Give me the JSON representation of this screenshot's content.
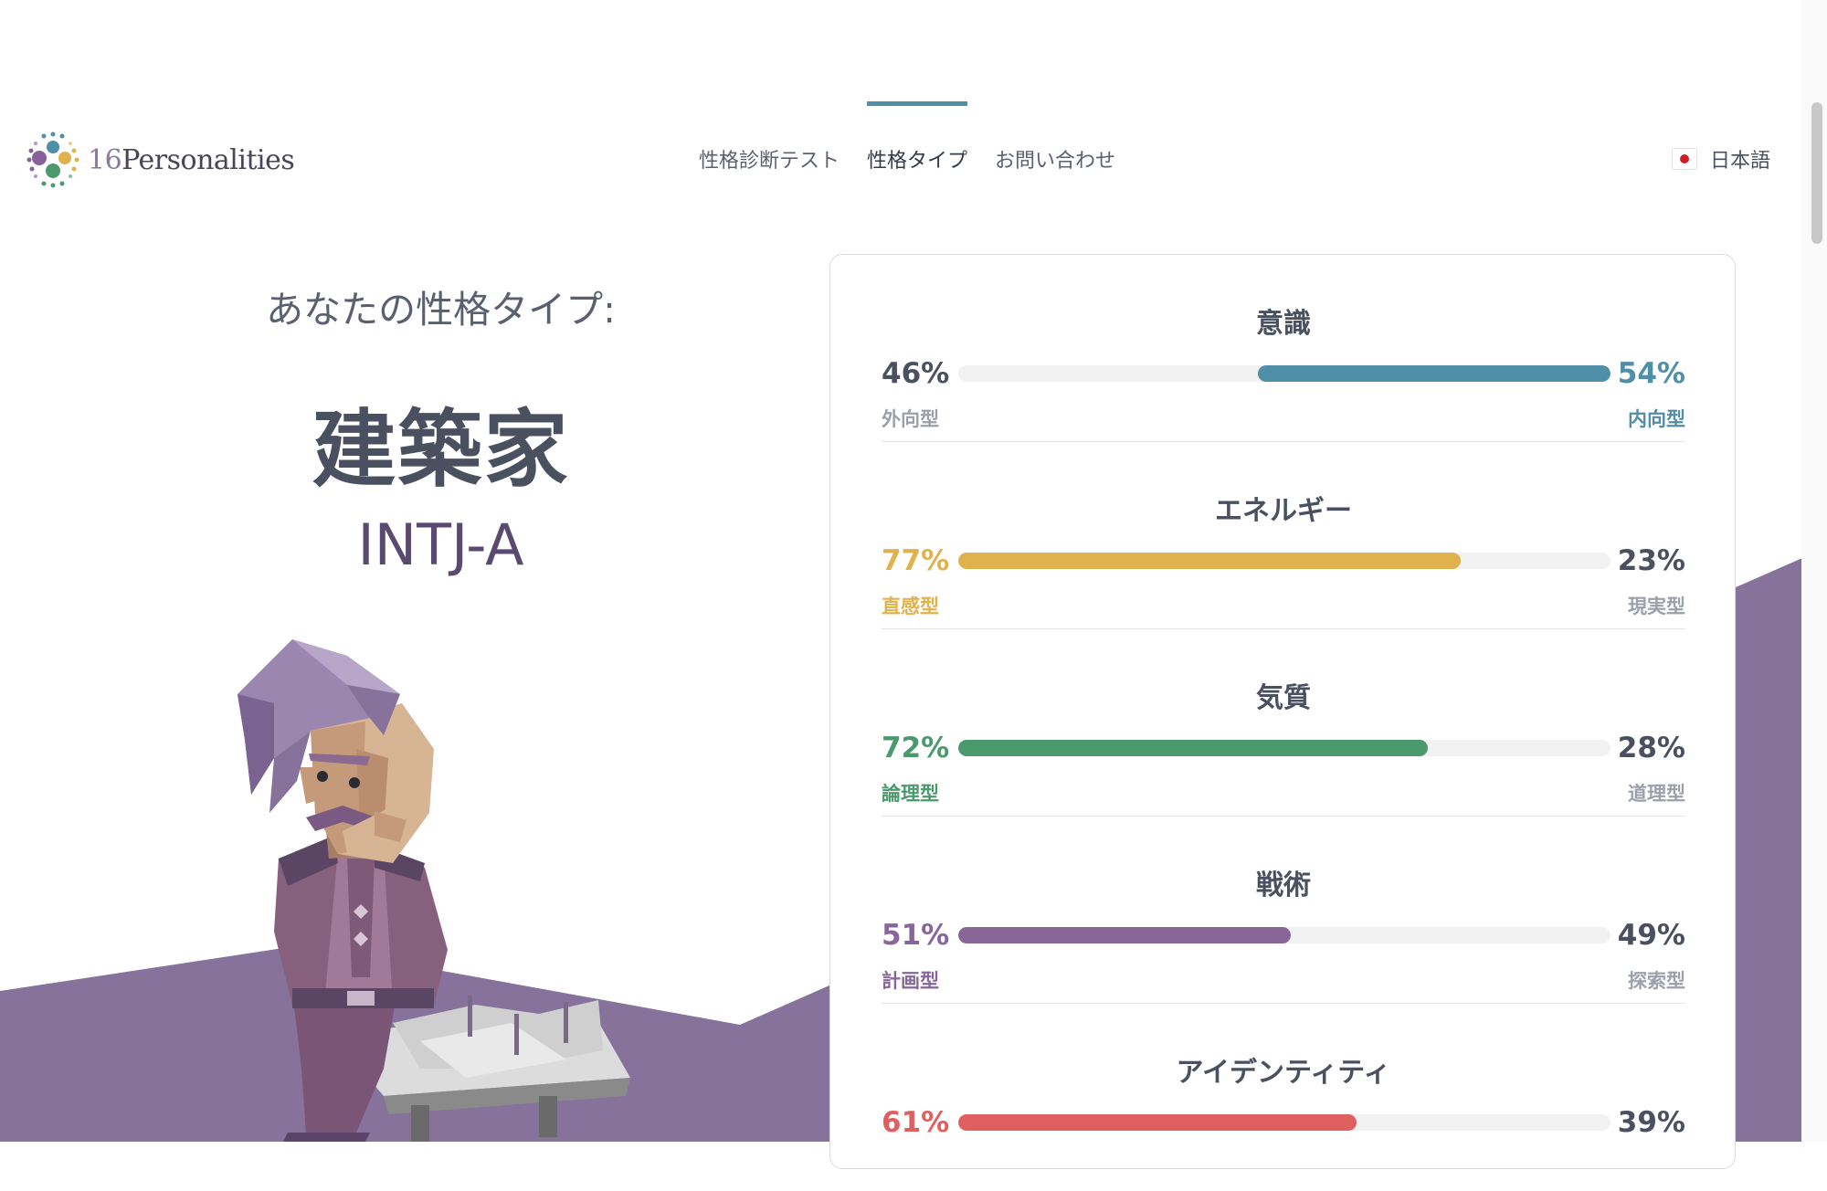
{
  "header": {
    "logo_number": "16",
    "logo_text": "Personalities",
    "nav": [
      {
        "label": "性格診断テスト",
        "active": false
      },
      {
        "label": "性格タイプ",
        "active": true
      },
      {
        "label": "お問い合わせ",
        "active": false
      }
    ],
    "language": "日本語"
  },
  "result": {
    "intro": "あなたの性格タイプ:",
    "type_name": "建築家",
    "type_code": "INTJ-A"
  },
  "traits": [
    {
      "title": "意識",
      "left_pct": "46%",
      "right_pct": "54%",
      "left_label": "外向型",
      "right_label": "内向型",
      "value": 54,
      "side": "right",
      "color": "#4f8fa8"
    },
    {
      "title": "エネルギー",
      "left_pct": "77%",
      "right_pct": "23%",
      "left_label": "直感型",
      "right_label": "現実型",
      "value": 77,
      "side": "left",
      "color": "#e0b24e"
    },
    {
      "title": "気質",
      "left_pct": "72%",
      "right_pct": "28%",
      "left_label": "論理型",
      "right_label": "道理型",
      "value": 72,
      "side": "left",
      "color": "#4a9a6e"
    },
    {
      "title": "戦術",
      "left_pct": "51%",
      "right_pct": "49%",
      "left_label": "計画型",
      "right_label": "探索型",
      "value": 51,
      "side": "left",
      "color": "#886699"
    },
    {
      "title": "アイデンティティ",
      "left_pct": "61%",
      "right_pct": "39%",
      "left_label": "",
      "right_label": "",
      "value": 61,
      "side": "left",
      "color": "#e06060"
    }
  ],
  "colors": {
    "accent": "#4f8fa8",
    "purple_bg": "#86729a",
    "text": "#4a5060"
  }
}
